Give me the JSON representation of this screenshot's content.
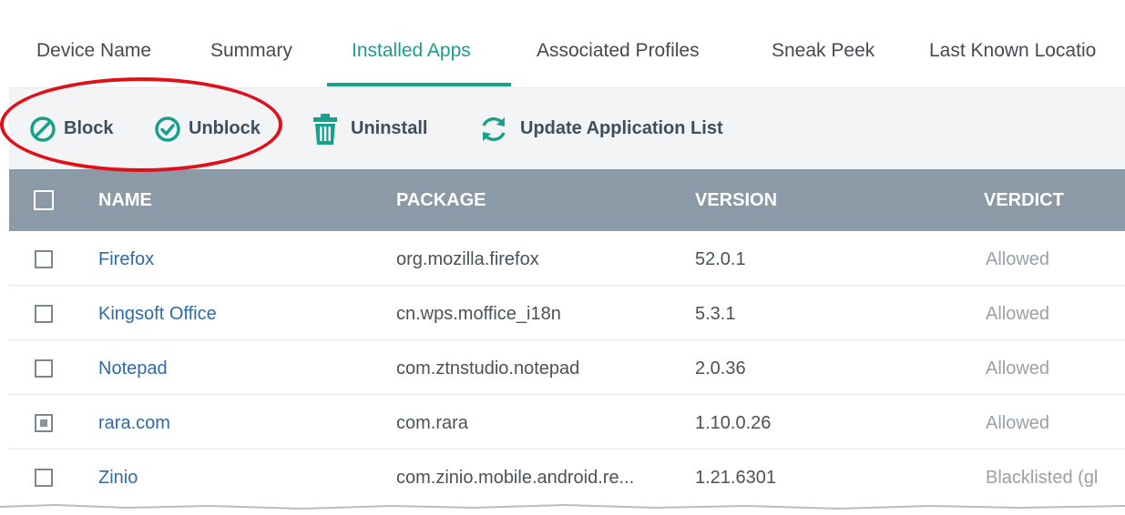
{
  "tabs": [
    {
      "label": "Device Name",
      "active": false
    },
    {
      "label": "Summary",
      "active": false
    },
    {
      "label": "Installed Apps",
      "active": true
    },
    {
      "label": "Associated Profiles",
      "active": false
    },
    {
      "label": "Sneak Peek",
      "active": false
    },
    {
      "label": "Last Known Locatio",
      "active": false
    }
  ],
  "toolbar": {
    "block_label": "Block",
    "unblock_label": "Unblock",
    "uninstall_label": "Uninstall",
    "update_label": "Update Application List"
  },
  "table": {
    "columns": [
      "NAME",
      "PACKAGE",
      "VERSION",
      "VERDICT"
    ],
    "rows": [
      {
        "name": "Firefox",
        "package": "org.mozilla.firefox",
        "version": "52.0.1",
        "verdict": "Allowed",
        "checked": false
      },
      {
        "name": "Kingsoft Office",
        "package": "cn.wps.moffice_i18n",
        "version": "5.3.1",
        "verdict": "Allowed",
        "checked": false
      },
      {
        "name": "Notepad",
        "package": "com.ztnstudio.notepad",
        "version": "2.0.36",
        "verdict": "Allowed",
        "checked": false
      },
      {
        "name": "rara.com",
        "package": "com.rara",
        "version": "1.10.0.26",
        "verdict": "Allowed",
        "checked": true
      },
      {
        "name": "Zinio",
        "package": "com.zinio.mobile.android.re...",
        "version": "1.21.6301",
        "verdict": "Blacklisted (gl",
        "checked": false
      }
    ]
  },
  "colors": {
    "accent": "#1ba08f",
    "header_bg": "#8b9aa6",
    "toolbar_bg": "#f3f4f5",
    "link": "#2f6aa6",
    "highlight": "#e0101a"
  },
  "icons": {
    "block": "block-icon",
    "unblock": "check-circle-icon",
    "uninstall": "trash-icon",
    "update": "refresh-icon"
  }
}
